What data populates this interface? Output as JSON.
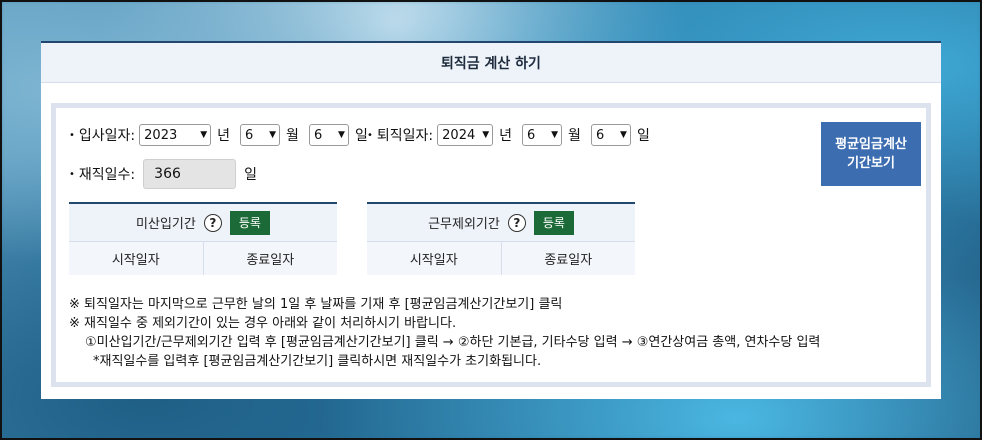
{
  "header": {
    "title": "퇴직금 계산 하기"
  },
  "hire": {
    "label": "입사일자:",
    "year": "2023",
    "month": "6",
    "day": "6",
    "unit_year": "년",
    "unit_month": "월",
    "unit_day": "일"
  },
  "retire": {
    "label": "퇴직일자:",
    "year": "2024",
    "month": "6",
    "day": "6",
    "unit_year": "년",
    "unit_month": "월",
    "unit_day": "일"
  },
  "days": {
    "label": "재직일수:",
    "value": "366",
    "unit": "일"
  },
  "calc_button": {
    "line1": "평균임금계산",
    "line2": "기간보기"
  },
  "unpaid_box": {
    "title": "미산입기간",
    "help": "?",
    "register": "등록",
    "col_start": "시작일자",
    "col_end": "종료일자"
  },
  "excluded_box": {
    "title": "근무제외기간",
    "help": "?",
    "register": "등록",
    "col_start": "시작일자",
    "col_end": "종료일자"
  },
  "notes": {
    "line1": "※ 퇴직일자는 마지막으로 근무한 날의 1일 후 날짜를 기재 후 [평균임금계산기간보기] 클릭",
    "line2": "※ 재직일수 중 제외기간이 있는 경우 아래와 같이 처리하시기 바랍니다.",
    "line3": "①미산입기간/근무제외기간 입력 후 [평균임금계산기간보기] 클릭 → ②하단 기본급, 기타수당 입력 → ③연간상여금 총액, 연차수당 입력",
    "line4": "*재직일수를 입력후 [평균임금계산기간보기] 클릭하시면 재직일수가 초기화됩니다."
  },
  "colors": {
    "accent": "#3c6db1",
    "register": "#1c6a37",
    "header_line": "#23466f"
  }
}
